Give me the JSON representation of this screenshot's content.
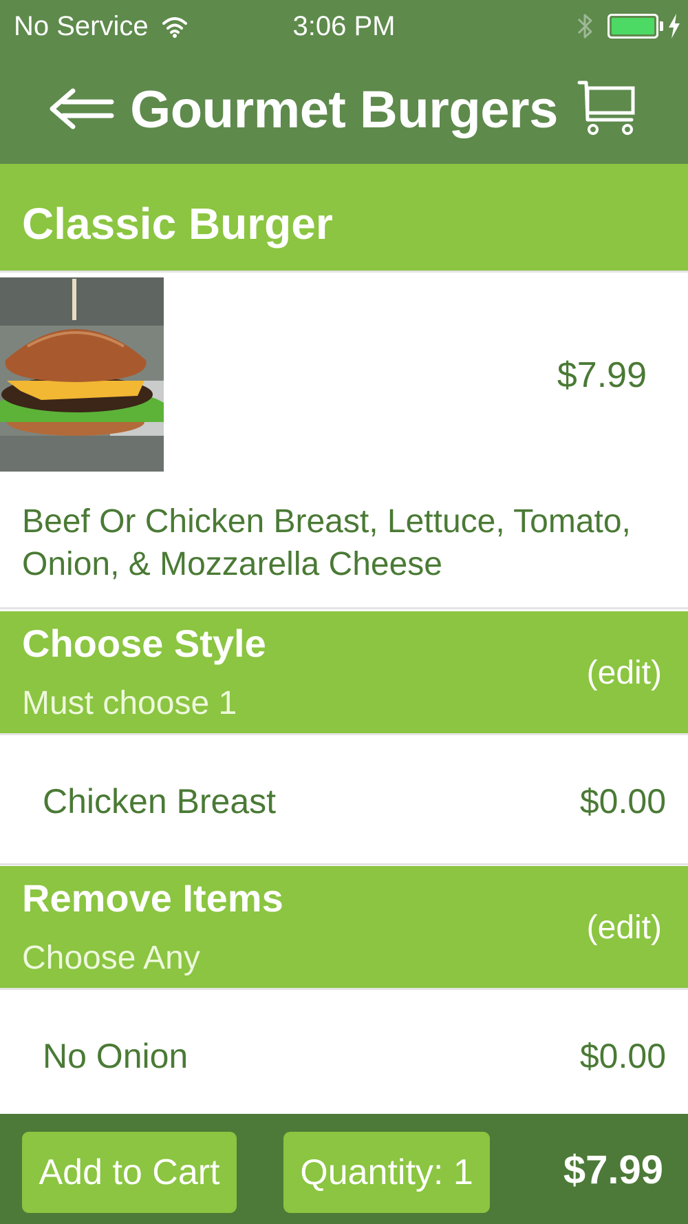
{
  "status_bar": {
    "carrier": "No Service",
    "time": "3:06 PM"
  },
  "nav": {
    "title": "Gourmet Burgers"
  },
  "item": {
    "name": "Classic Burger",
    "price": "$7.99",
    "description": "Beef Or Chicken Breast, Lettuce, Tomato, Onion, & Mozzarella Cheese"
  },
  "sections": [
    {
      "title": "Choose Style",
      "subtitle": "Must choose 1",
      "edit_label": "(edit)",
      "option": {
        "name": "Chicken Breast",
        "price": "$0.00"
      }
    },
    {
      "title": "Remove Items",
      "subtitle": "Choose Any",
      "edit_label": "(edit)",
      "option": {
        "name": "No Onion",
        "price": "$0.00"
      }
    }
  ],
  "bottom_bar": {
    "add_to_cart_label": "Add to Cart",
    "quantity_label": "Quantity: 1",
    "total": "$7.99"
  },
  "colors": {
    "nav_bg": "#5e8a4c",
    "accent_green": "#8bc541",
    "text_green": "#4a7a35",
    "bottom_bar_bg": "#4d7a38",
    "battery_fill": "#4cd964"
  },
  "icons": [
    "wifi-icon",
    "bluetooth-icon",
    "battery-icon",
    "charging-bolt-icon",
    "back-arrow-icon",
    "cart-icon"
  ]
}
